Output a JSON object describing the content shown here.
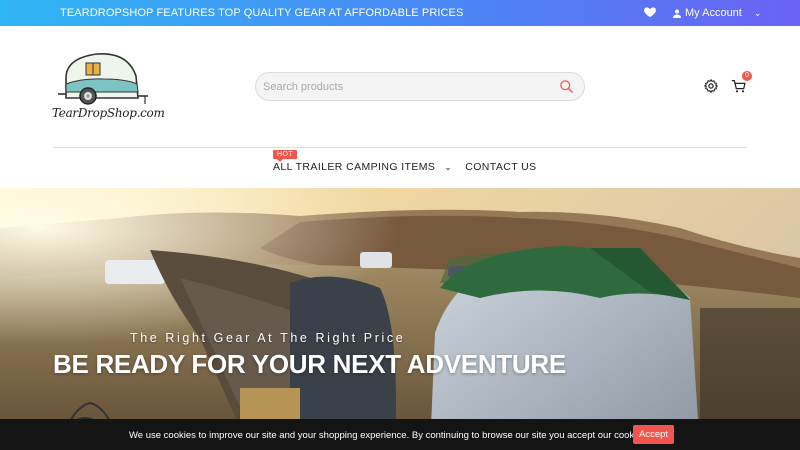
{
  "topbar": {
    "promo": "TEARDROPSHOP FEATURES TOP QUALITY GEAR AT AFFORDABLE PRICES",
    "wishlist_icon": "heart-icon",
    "account_label": "My Account",
    "account_icon": "user-icon"
  },
  "logo": {
    "text": "TearDropShop.com"
  },
  "search": {
    "placeholder": "Search products",
    "value": ""
  },
  "header_icons": {
    "settings": "gear-icon",
    "cart": "cart-icon",
    "cart_count": "0"
  },
  "nav": {
    "items": [
      {
        "label": "ALL TRAILER CAMPING ITEMS",
        "badge": "HOT",
        "has_dropdown": true
      },
      {
        "label": "CONTACT US",
        "has_dropdown": false
      }
    ]
  },
  "hero": {
    "tagline": "The Right Gear At The Right Price",
    "headline": "BE READY FOR YOUR NEXT ADVENTURE"
  },
  "cookie": {
    "message": "We use cookies to improve our site and your shopping experience. By continuing to browse our site you accept our cookie policy.",
    "accept_label": "Accept"
  },
  "colors": {
    "accent": "#f2554b",
    "gradient_start": "#2fb6f4",
    "gradient_end": "#6a63f4"
  }
}
